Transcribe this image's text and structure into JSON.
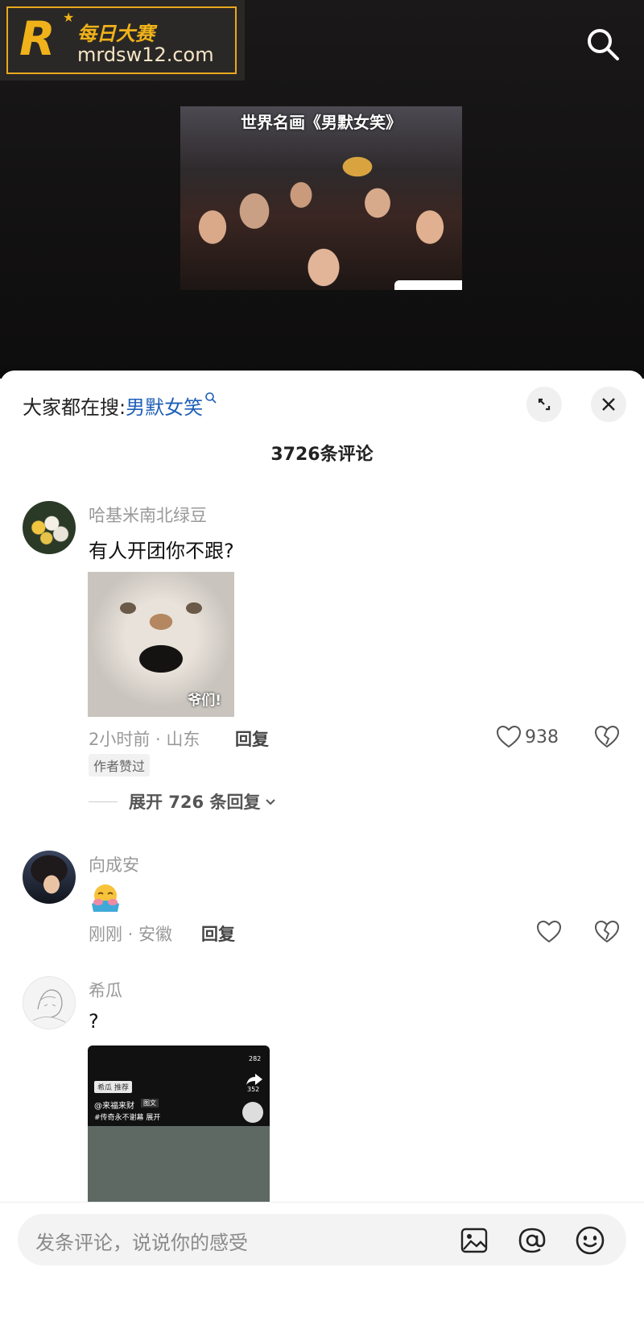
{
  "watermark": {
    "brand_name": "每日大赛",
    "domain": "mrdsw12.com",
    "mark": "R"
  },
  "video": {
    "caption": "世界名画《男默女笑》"
  },
  "sheet": {
    "search_prefix": "大家都在搜:",
    "search_keyword": "男默女笑",
    "comment_count": "3726条评论"
  },
  "comments": [
    {
      "username": "哈基米南北绿豆",
      "text": "有人开团你不跟?",
      "image_caption": "爷们!",
      "time_location": "2小时前 · 山东",
      "reply_label": "回复",
      "likes": "938",
      "badge": "作者赞过",
      "expand_label": "展开 726 条回复"
    },
    {
      "username": "向成安",
      "time_location": "刚刚 · 安徽",
      "reply_label": "回复"
    },
    {
      "username": "希瓜",
      "text": "?",
      "thumb": {
        "chip": "希瓜 推荐",
        "account": "@来福来财",
        "tag": "图文",
        "hashtag": "#传奇永不谢幕 展开",
        "count1": "282",
        "count2": "352"
      }
    }
  ],
  "composer": {
    "placeholder": "发条评论，说说你的感受"
  }
}
